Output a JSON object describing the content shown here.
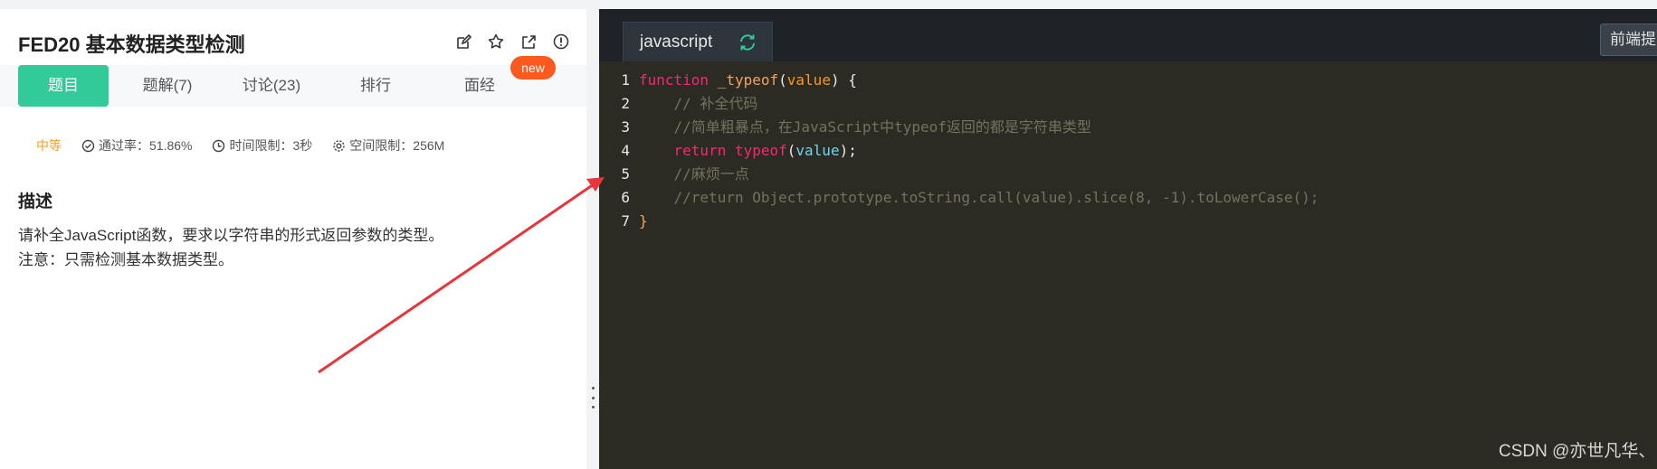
{
  "problem": {
    "title": "FED20  基本数据类型检测",
    "tabs": [
      {
        "label": "题目"
      },
      {
        "label": "题解(7)"
      },
      {
        "label": "讨论(23)"
      },
      {
        "label": "排行"
      },
      {
        "label": "面经"
      }
    ],
    "new_badge": "new",
    "difficulty": "中等",
    "pass_rate": "通过率：51.86%",
    "time_limit": "时间限制：3秒",
    "space_limit": "空间限制：256M",
    "desc_heading": "描述",
    "desc_line1": "请补全JavaScript函数，要求以字符串的形式返回参数的类型。",
    "desc_line2": "注意：只需检测基本数据类型。"
  },
  "editor": {
    "language": "javascript",
    "right_button": "前端提",
    "line_numbers": [
      "1",
      "2",
      "3",
      "4",
      "5",
      "6",
      "7"
    ],
    "code": {
      "l1_kw": "function",
      "l1_name": "_typeof",
      "l1_open": "(",
      "l1_param": "value",
      "l1_close": ") {",
      "l2": "// 补全代码",
      "l3": "//简单粗暴点，在JavaScript中typeof返回的都是字符串类型",
      "l4_kw": "return",
      "l4_fn": "typeof",
      "l4_open": "(",
      "l4_param": "value",
      "l4_close": ");",
      "l5": "//麻烦一点",
      "l6": "//return Object.prototype.toString.call(value).slice(8, -1).toLowerCase();",
      "l7": "}"
    },
    "colors": {
      "bg": "#2b2b24",
      "keyword": "#f92672",
      "function": "#f4a261",
      "comment": "#75715e"
    }
  },
  "watermark": "CSDN @亦世凡华、",
  "colors": {
    "accent": "#32ca99",
    "badge": "#fa5a1e",
    "arrow": "#e8353b"
  }
}
